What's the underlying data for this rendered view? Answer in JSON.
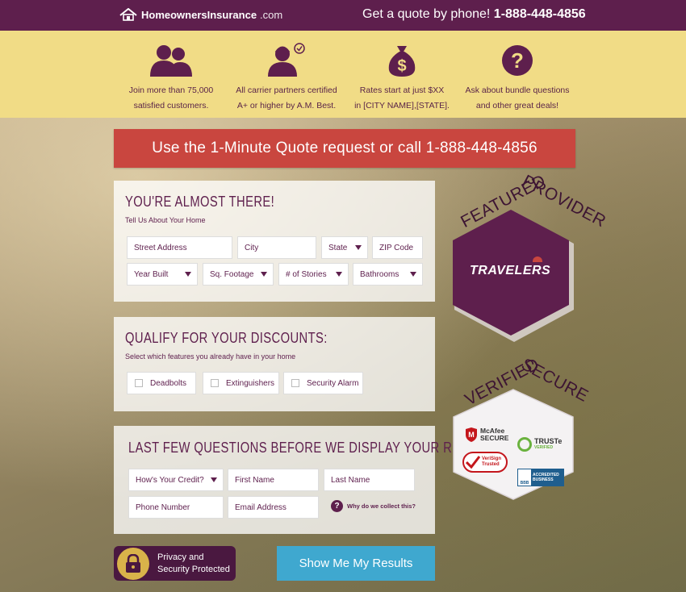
{
  "header": {
    "logo_name": "HomeownersInsurance",
    "logo_tld": ".com",
    "phone_prefix": "Get a quote by phone!",
    "phone_number": "1-888-448-4856"
  },
  "features": [
    {
      "icon": "people-icon",
      "line1": "Join more than 75,000",
      "line2": "satisfied customers."
    },
    {
      "icon": "agent-certified-icon",
      "line1": "All carrier partners certified",
      "line2": "A+ or higher by A.M. Best."
    },
    {
      "icon": "money-bag-icon",
      "line1": "Rates start at just $XX",
      "line2": "in [CITY NAME],[STATE]."
    },
    {
      "icon": "question-icon",
      "line1": "Ask about bundle questions",
      "line2": "and other great deals!"
    }
  ],
  "cta": "Use the 1-Minute Quote request or call 1-888-448-4856",
  "home_panel": {
    "title": "You're almost there!",
    "subtitle": "Tell Us About Your Home",
    "street": "Street Address",
    "city": "City",
    "state": "State",
    "zip": "ZIP Code",
    "year_built": "Year Built",
    "sq_footage": "Sq. Footage",
    "stories": "# of Stories",
    "bathrooms": "Bathrooms"
  },
  "discount_panel": {
    "title": "Qualify for your discounts:",
    "subtitle": "Select which features you already have in your home",
    "options": [
      "Deadbolts",
      "Extinguishers",
      "Security Alarm"
    ]
  },
  "last_panel": {
    "title": "Last few questions before we display your results",
    "credit": "How's Your Credit?",
    "first_name": "First Name",
    "last_name": "Last Name",
    "phone": "Phone Number",
    "email": "Email Address",
    "why": "Why do we collect this?"
  },
  "privacy": {
    "line1": "Privacy and",
    "line2": "Security Protected"
  },
  "submit_label": "Show Me My Results",
  "featured": {
    "word1": "Featured",
    "word2": "Provider",
    "provider": "TRAVELERS"
  },
  "verified": {
    "word1": "Verified",
    "word2": "Secure",
    "badges": {
      "mcafee1": "McAfee",
      "mcafee2": "SECURE",
      "truste": "TRUSTe",
      "truste_sub": "VERIFIED",
      "verisign1": "VeriSign",
      "verisign2": "Trusted",
      "bbb1": "ACCREDITED",
      "bbb2": "BUSINESS",
      "bbb_tag": "BBB"
    }
  },
  "colors": {
    "plum": "#5e1f4d",
    "yellow": "#f1dc86",
    "cta_red": "#c9463f",
    "submit_blue": "#3fa8cf"
  }
}
